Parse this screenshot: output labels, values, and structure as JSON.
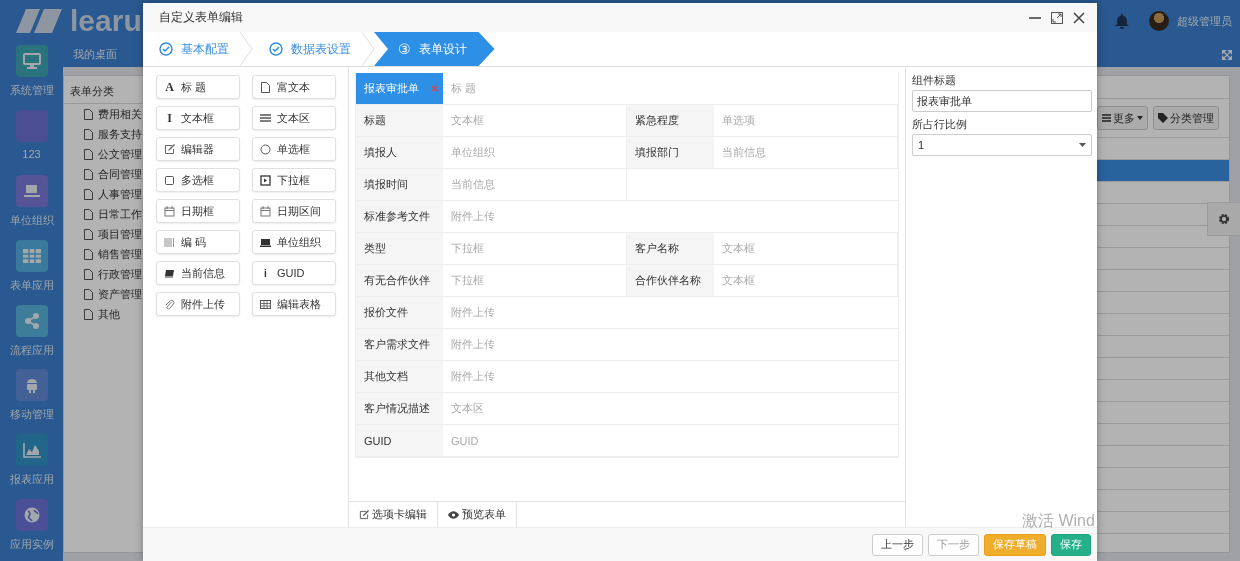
{
  "app": {
    "logo": "learu",
    "tabs": [
      "我的桌面"
    ],
    "user": "超级管理员"
  },
  "nav": [
    {
      "label": "系统管理",
      "color": "#2c747d"
    },
    {
      "label": "123",
      "color": "#4c4e94"
    },
    {
      "label": "单位组织",
      "color": "#555497"
    },
    {
      "label": "表单应用",
      "color": "#3b7a9d"
    },
    {
      "label": "流程应用",
      "color": "#3e7d9a"
    },
    {
      "label": "移动管理",
      "color": "#436196"
    },
    {
      "label": "报表应用",
      "color": "#216589"
    },
    {
      "label": "应用实例",
      "color": "#4b4f95"
    }
  ],
  "category_panel": {
    "title": "表单分类",
    "items": [
      "费用相关",
      "服务支持",
      "公文管理",
      "合同管理",
      "人事管理",
      "日常工作",
      "项目管理",
      "销售管理",
      "行政管理",
      "资产管理",
      "其他"
    ]
  },
  "toolbar": {
    "buttons": [
      {
        "label": "更多",
        "kind": "menu"
      },
      {
        "label": "分类管理",
        "kind": "tag"
      }
    ]
  },
  "grid": {
    "rows": [
      {
        "selected": false
      },
      {
        "selected": true
      },
      {
        "selected": false
      },
      {
        "selected": false
      },
      {
        "selected": false
      },
      {
        "selected": false
      },
      {
        "selected": false
      },
      {
        "selected": false
      },
      {
        "selected": false
      },
      {
        "selected": false
      },
      {
        "selected": false
      },
      {
        "selected": false
      },
      {
        "selected": false
      },
      {
        "selected": false
      },
      {
        "selected": false
      },
      {
        "selected": false
      },
      {
        "selected": false
      },
      {
        "selected": false
      }
    ]
  },
  "dialog": {
    "title": "自定义表单编辑",
    "steps": [
      {
        "label": "基本配置",
        "done": true,
        "selected": false
      },
      {
        "label": "数据表设置",
        "done": true,
        "selected": false
      },
      {
        "label": "表单设计",
        "done": false,
        "selected": true,
        "marker": "③"
      }
    ],
    "palette": [
      {
        "label": "标 题",
        "glyph": "A"
      },
      {
        "label": "富文本"
      },
      {
        "label": "文本框",
        "glyph": "I"
      },
      {
        "label": "文本区"
      },
      {
        "label": "编辑器"
      },
      {
        "label": "单选框"
      },
      {
        "label": "多选框"
      },
      {
        "label": "下拉框"
      },
      {
        "label": "日期框"
      },
      {
        "label": "日期区间"
      },
      {
        "label": "编 码"
      },
      {
        "label": "单位组织"
      },
      {
        "label": "当前信息"
      },
      {
        "label": "GUID",
        "glyph": "i"
      },
      {
        "label": "附件上传"
      },
      {
        "label": "编辑表格"
      }
    ],
    "form": {
      "header": {
        "label": "报表审批单",
        "placeholder": "标 题",
        "selected": true
      },
      "rows": [
        {
          "kind": "split",
          "cells": [
            {
              "label": "标题",
              "placeholder": "文本框"
            },
            {
              "label": "紧急程度",
              "placeholder": "单选项"
            }
          ]
        },
        {
          "kind": "split",
          "cells": [
            {
              "label": "填报人",
              "placeholder": "单位组织"
            },
            {
              "label": "填报部门",
              "placeholder": "当前信息"
            }
          ]
        },
        {
          "kind": "split",
          "cells": [
            {
              "label": "填报时间",
              "placeholder": "当前信息"
            }
          ]
        },
        {
          "kind": "full",
          "cells": [
            {
              "label": "标准参考文件",
              "placeholder": "附件上传"
            }
          ]
        },
        {
          "kind": "split",
          "cells": [
            {
              "label": "类型",
              "placeholder": "下拉框"
            },
            {
              "label": "客户名称",
              "placeholder": "文本框"
            }
          ]
        },
        {
          "kind": "split",
          "cells": [
            {
              "label": "有无合作伙伴",
              "placeholder": "下拉框"
            },
            {
              "label": "合作伙伴名称",
              "placeholder": "文本框"
            }
          ]
        },
        {
          "kind": "full",
          "cells": [
            {
              "label": "报价文件",
              "placeholder": "附件上传"
            }
          ]
        },
        {
          "kind": "full",
          "cells": [
            {
              "label": "客户需求文件",
              "placeholder": "附件上传"
            }
          ]
        },
        {
          "kind": "full",
          "cells": [
            {
              "label": "其他文档",
              "placeholder": "附件上传"
            }
          ]
        },
        {
          "kind": "full",
          "cells": [
            {
              "label": "客户情况描述",
              "placeholder": "文本区"
            }
          ]
        },
        {
          "kind": "full",
          "cells": [
            {
              "label": "GUID",
              "placeholder": "GUID"
            }
          ]
        }
      ]
    },
    "form_tabs": [
      {
        "label": "选项卡编辑",
        "kind": "edit"
      },
      {
        "label": "预览表单",
        "kind": "preview"
      }
    ],
    "properties": [
      {
        "label": "组件标题",
        "kind": "text",
        "value": "报表审批单"
      },
      {
        "label": "所占行比例",
        "kind": "select",
        "value": "1"
      }
    ],
    "buttons": [
      {
        "label": "上一步",
        "kind": "default",
        "disabled": false
      },
      {
        "label": "下一步",
        "kind": "default",
        "disabled": true
      },
      {
        "label": "保存草稿",
        "kind": "warning",
        "disabled": false
      },
      {
        "label": "保存",
        "kind": "success",
        "disabled": false
      }
    ]
  },
  "system_notice": "激活 Wind"
}
